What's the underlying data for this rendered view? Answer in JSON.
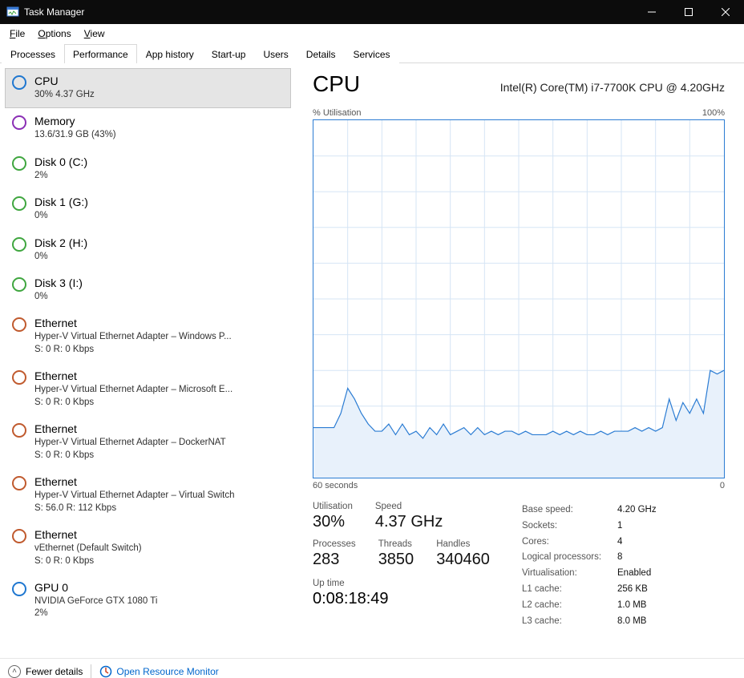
{
  "window": {
    "title": "Task Manager"
  },
  "menu": [
    "File",
    "Options",
    "View"
  ],
  "tabs": [
    "Processes",
    "Performance",
    "App history",
    "Start-up",
    "Users",
    "Details",
    "Services"
  ],
  "active_tab": 1,
  "sidebar": [
    {
      "icon": "cpu",
      "title": "CPU",
      "subs": [
        "30%  4.37 GHz"
      ],
      "selected": true
    },
    {
      "icon": "mem",
      "title": "Memory",
      "subs": [
        "13.6/31.9 GB (43%)"
      ]
    },
    {
      "icon": "disk",
      "title": "Disk 0 (C:)",
      "subs": [
        "2%"
      ]
    },
    {
      "icon": "disk",
      "title": "Disk 1 (G:)",
      "subs": [
        "0%"
      ]
    },
    {
      "icon": "disk",
      "title": "Disk 2 (H:)",
      "subs": [
        "0%"
      ]
    },
    {
      "icon": "disk",
      "title": "Disk 3 (I:)",
      "subs": [
        "0%"
      ]
    },
    {
      "icon": "net",
      "title": "Ethernet",
      "subs": [
        "Hyper-V Virtual Ethernet Adapter – Windows P...",
        "S: 0  R: 0 Kbps"
      ]
    },
    {
      "icon": "net",
      "title": "Ethernet",
      "subs": [
        "Hyper-V Virtual Ethernet Adapter – Microsoft E...",
        "S: 0  R: 0 Kbps"
      ]
    },
    {
      "icon": "net",
      "title": "Ethernet",
      "subs": [
        "Hyper-V Virtual Ethernet Adapter – DockerNAT",
        "S: 0  R: 0 Kbps"
      ]
    },
    {
      "icon": "net",
      "title": "Ethernet",
      "subs": [
        "Hyper-V Virtual Ethernet Adapter – Virtual Switch",
        "S: 56.0  R: 112 Kbps"
      ]
    },
    {
      "icon": "net",
      "title": "Ethernet",
      "subs": [
        "vEthernet (Default Switch)",
        "S: 0  R: 0 Kbps"
      ]
    },
    {
      "icon": "gpu",
      "title": "GPU 0",
      "subs": [
        "NVIDIA GeForce GTX 1080 Ti",
        "2%"
      ]
    }
  ],
  "main": {
    "title": "CPU",
    "model": "Intel(R) Core(TM) i7-7700K CPU @ 4.20GHz",
    "chart_top_left": "% Utilisation",
    "chart_top_right": "100%",
    "chart_bot_left": "60 seconds",
    "chart_bot_right": "0",
    "stats_row1": [
      {
        "lbl": "Utilisation",
        "val": "30%"
      },
      {
        "lbl": "Speed",
        "val": "4.37 GHz"
      }
    ],
    "stats_row2": [
      {
        "lbl": "Processes",
        "val": "283"
      },
      {
        "lbl": "Threads",
        "val": "3850"
      },
      {
        "lbl": "Handles",
        "val": "340460"
      }
    ],
    "uptime_lbl": "Up time",
    "uptime_val": "0:08:18:49",
    "kv": [
      [
        "Base speed:",
        "4.20 GHz"
      ],
      [
        "Sockets:",
        "1"
      ],
      [
        "Cores:",
        "4"
      ],
      [
        "Logical processors:",
        "8"
      ],
      [
        "Virtualisation:",
        "Enabled"
      ],
      [
        "L1 cache:",
        "256 KB"
      ],
      [
        "L2 cache:",
        "1.0 MB"
      ],
      [
        "L3 cache:",
        "8.0 MB"
      ]
    ]
  },
  "footer": {
    "fewer": "Fewer details",
    "resmon": "Open Resource Monitor"
  },
  "chart_data": {
    "type": "area",
    "title": "% Utilisation",
    "xlabel": "seconds",
    "ylabel": "% Utilisation",
    "xlim": [
      60,
      0
    ],
    "ylim": [
      0,
      100
    ],
    "x": [
      60,
      59,
      58,
      57,
      56,
      55,
      54,
      53,
      52,
      51,
      50,
      49,
      48,
      47,
      46,
      45,
      44,
      43,
      42,
      41,
      40,
      39,
      38,
      37,
      36,
      35,
      34,
      33,
      32,
      31,
      30,
      29,
      28,
      27,
      26,
      25,
      24,
      23,
      22,
      21,
      20,
      19,
      18,
      17,
      16,
      15,
      14,
      13,
      12,
      11,
      10,
      9,
      8,
      7,
      6,
      5,
      4,
      3,
      2,
      1,
      0
    ],
    "values": [
      14,
      14,
      14,
      14,
      18,
      25,
      22,
      18,
      15,
      13,
      13,
      15,
      12,
      15,
      12,
      13,
      11,
      14,
      12,
      15,
      12,
      13,
      14,
      12,
      14,
      12,
      13,
      12,
      13,
      13,
      12,
      13,
      12,
      12,
      12,
      13,
      12,
      13,
      12,
      13,
      12,
      12,
      13,
      12,
      13,
      13,
      13,
      14,
      13,
      14,
      13,
      14,
      22,
      16,
      21,
      18,
      22,
      18,
      30,
      29,
      30
    ]
  }
}
